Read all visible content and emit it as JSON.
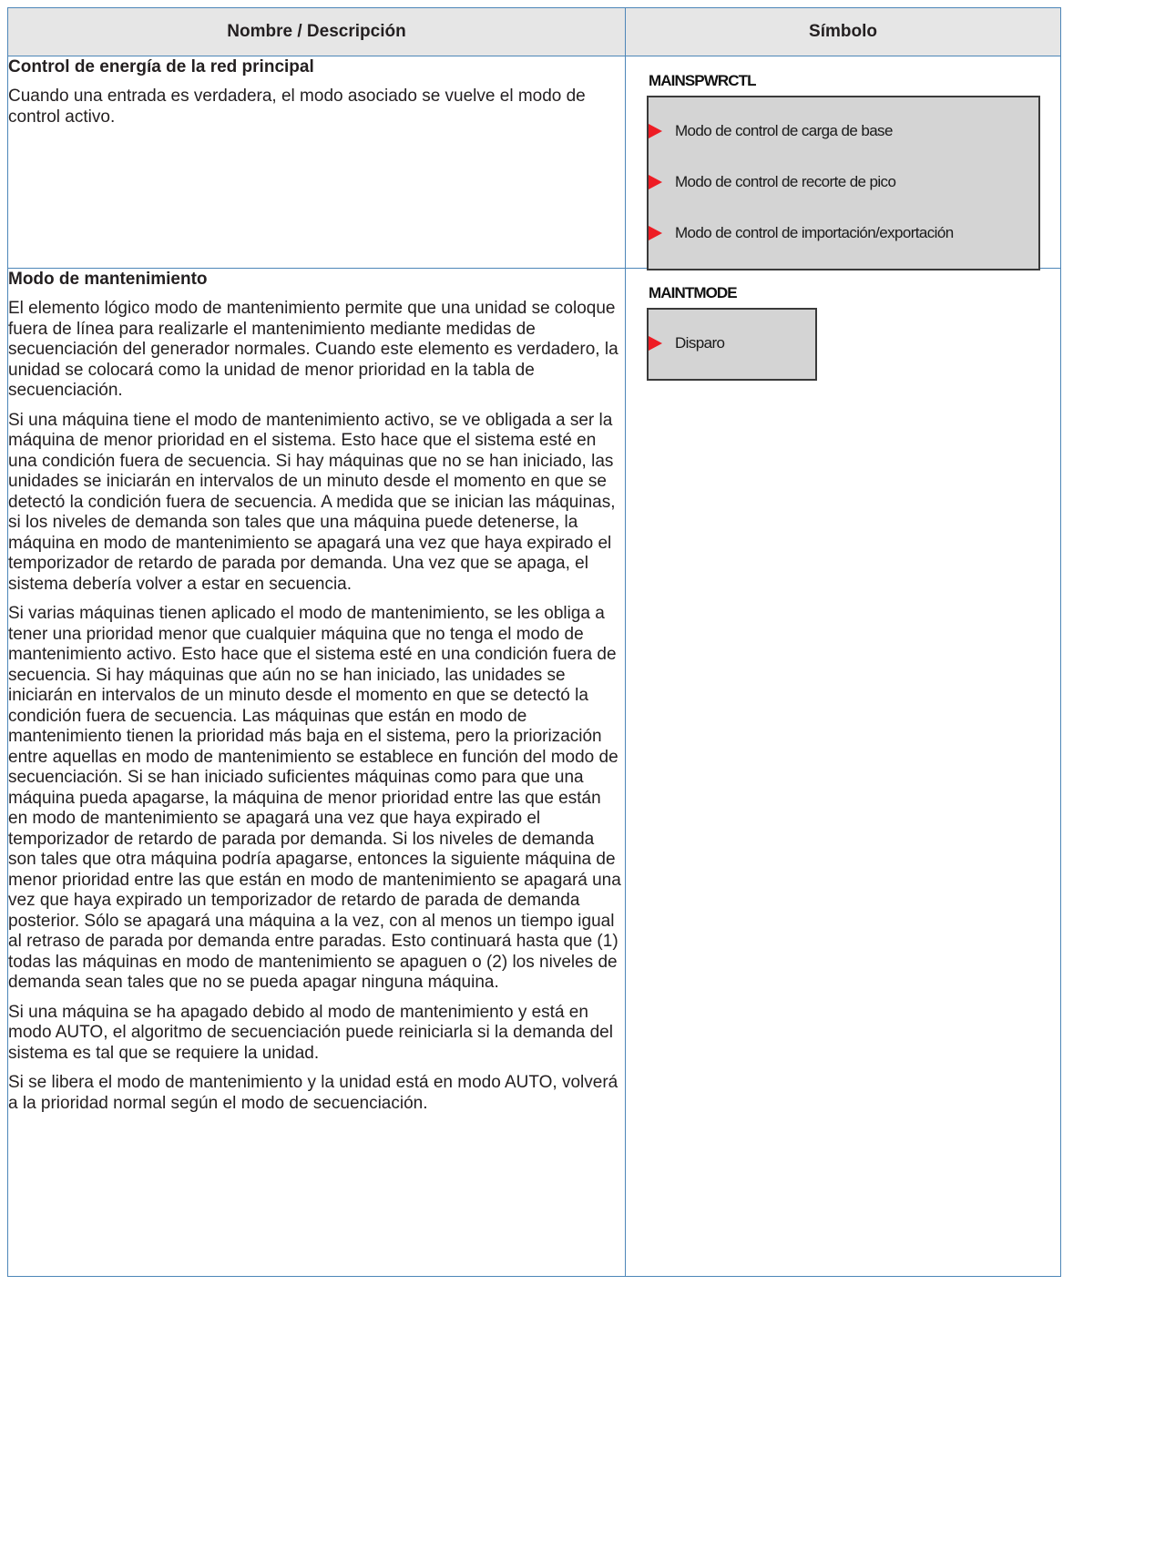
{
  "table": {
    "headers": {
      "description": "Nombre / Descripción",
      "symbol": "Símbolo"
    },
    "rows": [
      {
        "title": "Control de energía de la red principal",
        "paragraphs": [
          "Cuando una entrada es verdadera, el modo asociado se vuelve el modo de control activo."
        ],
        "symbol": {
          "name": "MAINSPWRCTL",
          "inputs": [
            "Modo de control de carga de base",
            "Modo de control de recorte de pico",
            "Modo de control de importación/exportación"
          ]
        }
      },
      {
        "title": "Modo de mantenimiento",
        "paragraphs": [
          "El elemento lógico modo de mantenimiento permite que una unidad se coloque fuera de línea para realizarle el mantenimiento mediante medidas de secuenciación del generador normales. Cuando este elemento es verdadero, la unidad se colocará como la unidad de menor prioridad en la tabla de secuenciación.",
          "Si una máquina tiene el modo de mantenimiento activo, se ve obligada a ser la máquina de menor prioridad en el sistema. Esto hace que el sistema esté en una condición fuera de secuencia. Si hay máquinas que no se han iniciado, las unidades se iniciarán en intervalos de un minuto desde el momento en que se detectó la condición fuera de secuencia. A medida que se inician las máquinas, si los niveles de demanda son tales que una máquina puede detenerse, la máquina en modo de mantenimiento se apagará una vez que haya expirado el temporizador de retardo de parada por demanda. Una vez que se apaga, el sistema debería volver a estar en secuencia.",
          "Si varias máquinas tienen aplicado el modo de mantenimiento, se les obliga a tener una prioridad menor que cualquier máquina que no tenga el modo de mantenimiento activo. Esto hace que el sistema esté en una condición fuera de secuencia. Si hay máquinas que aún no se han iniciado, las unidades se iniciarán en intervalos de un minuto desde el momento en que se detectó la condición fuera de secuencia. Las máquinas que están en modo de mantenimiento tienen la prioridad más baja en el sistema, pero la priorización entre aquellas en modo de mantenimiento se establece en función del modo de secuenciación. Si se han iniciado suficientes máquinas como para que una máquina pueda apagarse, la máquina de menor prioridad entre las que están en modo de mantenimiento se apagará una vez que haya expirado el temporizador de retardo de parada por demanda. Si los niveles de demanda son tales que otra máquina podría apagarse, entonces la siguiente máquina de menor prioridad entre las que están en modo de mantenimiento se apagará una vez que haya expirado un temporizador de retardo de parada de demanda posterior. Sólo se apagará una máquina a la vez, con al menos un tiempo igual al retraso de parada por demanda entre paradas. Esto continuará hasta que (1) todas las máquinas en modo de mantenimiento se apaguen o (2) los niveles de demanda sean tales que no se pueda apagar ninguna máquina.",
          "Si una máquina se ha apagado debido al modo de mantenimiento y está en modo AUTO, el algoritmo de secuenciación puede reiniciarla si la demanda del sistema es tal que se requiere la unidad.",
          "Si se libera el modo de mantenimiento y la unidad está en modo AUTO, volverá a la prioridad normal según el modo de secuenciación."
        ],
        "symbol": {
          "name": "MAINTMODE",
          "inputs": [
            "Disparo"
          ]
        }
      }
    ]
  },
  "colors": {
    "border": "#4d86b8",
    "header_bg": "#e6e6e6",
    "block_fill": "#d4d4d4",
    "pin_arrow": "#ee1c24"
  }
}
